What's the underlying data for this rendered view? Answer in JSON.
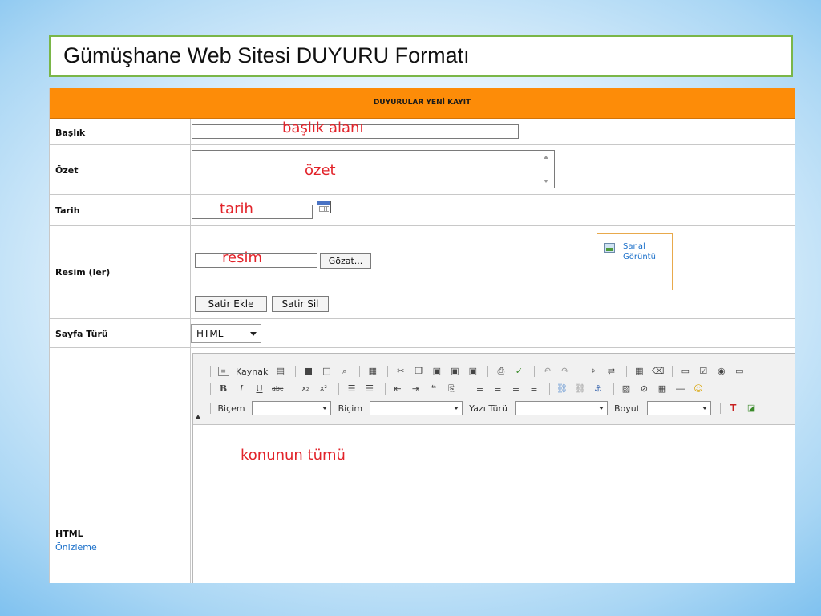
{
  "slide": {
    "title": "Gümüşhane Web Sitesi DUYURU Formatı"
  },
  "form": {
    "header": "DUYURULAR YENİ KAYIT",
    "rows": {
      "baslik": {
        "label": "Başlık",
        "annotation": "başlık alanı"
      },
      "ozet": {
        "label": "Özet",
        "annotation": "özet"
      },
      "tarih": {
        "label": "Tarih",
        "annotation": "tarih"
      },
      "resim": {
        "label": "Resim (ler)",
        "annotation": "resim",
        "browse_label": "Gözat...",
        "add_row_label": "Satir Ekle",
        "delete_row_label": "Satir Sil",
        "preview_label": "Sanal Görüntü"
      },
      "sayfa_turu": {
        "label": "Sayfa Türü",
        "selected": "HTML"
      },
      "html": {
        "label": "HTML",
        "sublabel": "Önizleme",
        "annotation": "konunun tümü",
        "toolbar": {
          "source_label": "Kaynak",
          "style_label": "Biçem",
          "format_label": "Biçim",
          "font_label": "Yazı Türü",
          "size_label": "Boyut"
        }
      }
    }
  },
  "colors": {
    "header_bg": "#fd8c08",
    "annotation_red": "#e2232a",
    "link_blue": "#1a6fc9",
    "title_border": "#7ab648"
  }
}
